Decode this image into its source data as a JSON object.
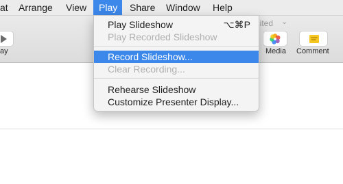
{
  "menubar": {
    "items": [
      "at",
      "Arrange",
      "View",
      "Play",
      "Share",
      "Window",
      "Help"
    ],
    "active": "Play"
  },
  "toolbar": {
    "play_label": "ay",
    "doc_title": "dited",
    "media_label": "Media",
    "comment_label": "Comment"
  },
  "play_menu": {
    "items": [
      {
        "label": "Play Slideshow",
        "shortcut": "⌥⌘P",
        "enabled": true
      },
      {
        "label": "Play Recorded Slideshow",
        "enabled": false
      },
      {
        "label": "Record Slideshow...",
        "enabled": true,
        "highlighted": true
      },
      {
        "label": "Clear Recording...",
        "enabled": false
      },
      {
        "label": "Rehearse Slideshow",
        "enabled": true
      },
      {
        "label": "Customize Presenter Display...",
        "enabled": true
      }
    ]
  },
  "colors": {
    "accent": "#3c87ea",
    "menubar_bg": "#ececec",
    "disabled_text": "#b0b0b0"
  }
}
